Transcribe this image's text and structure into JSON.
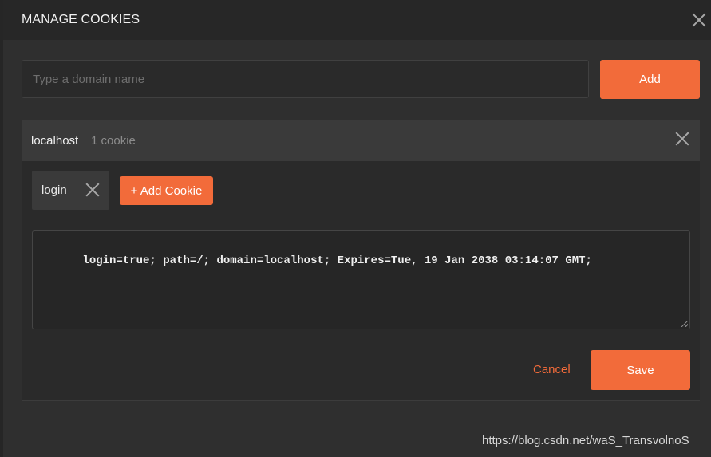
{
  "modal": {
    "title": "MANAGE COOKIES"
  },
  "domain_form": {
    "placeholder": "Type a domain name",
    "value": "",
    "add_label": "Add"
  },
  "domains": [
    {
      "name": "localhost",
      "count_label": "1 cookie",
      "cookies": [
        {
          "name": "login"
        }
      ],
      "add_cookie_label": "+ Add Cookie",
      "cookie_text": "login=true; path=/; domain=localhost; Expires=Tue, 19 Jan 2038 03:14:07 GMT;",
      "cancel_label": "Cancel",
      "save_label": "Save"
    }
  ],
  "watermark": "https://blog.csdn.net/waS_TransvolnoS",
  "colors": {
    "accent": "#f26b3a",
    "background": "#2f2f2f",
    "card_header": "#3a3a3a"
  },
  "icons": {
    "close": "close-icon",
    "remove_cookie": "close-icon",
    "remove_domain": "close-icon",
    "resize": "resize-grip-icon"
  }
}
